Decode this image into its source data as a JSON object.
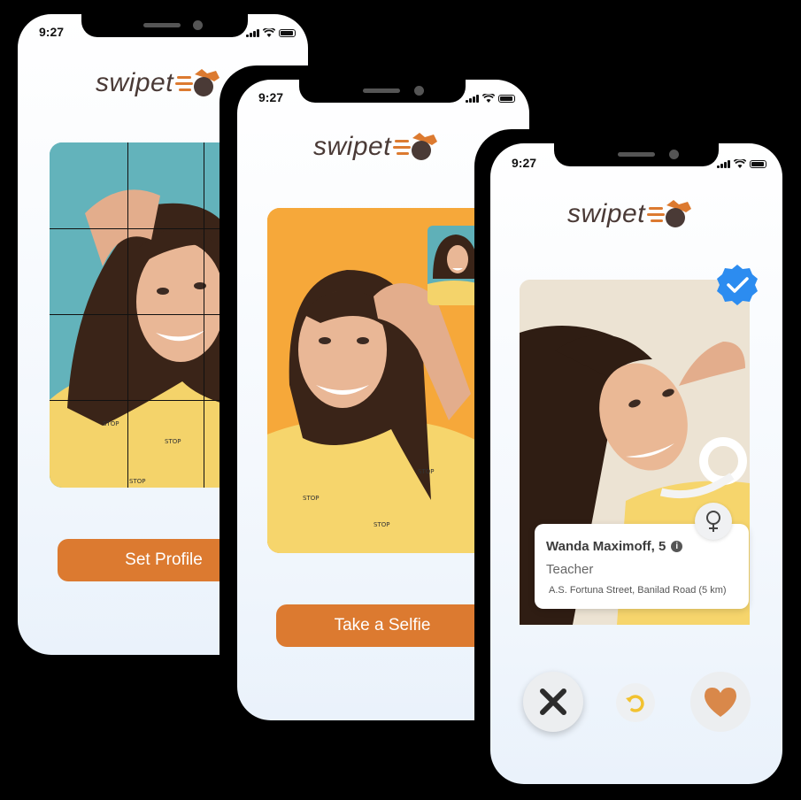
{
  "status_bar": {
    "time": "9:27"
  },
  "brand": {
    "name": "swipet",
    "accent": "#dc7a30",
    "text_color": "#4a3a36"
  },
  "screens": {
    "profile": {
      "button_label": "Set Profile"
    },
    "selfie": {
      "button_label": "Take a Selfie"
    },
    "match": {
      "name": "Wanda Maximoff, 5",
      "occupation": "Teacher",
      "address": "A.S. Fortuna Street, Banilad Road (5 km)",
      "verified": true,
      "gender_icon": "female-icon",
      "actions": [
        "close-icon",
        "undo-icon",
        "heart-icon"
      ]
    }
  }
}
